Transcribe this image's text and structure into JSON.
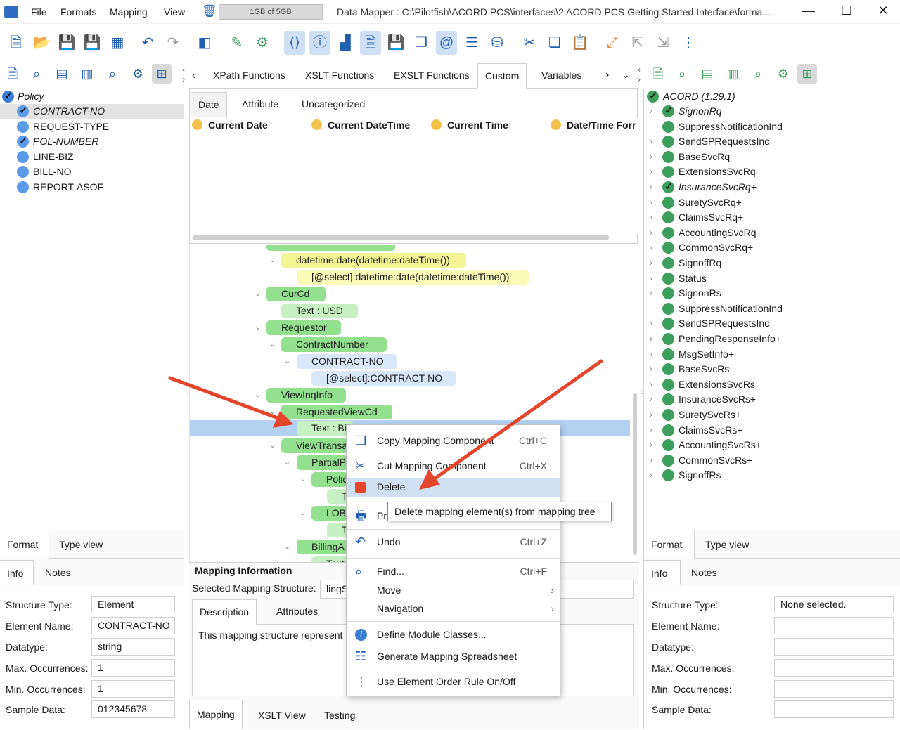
{
  "menubar": {
    "items": [
      "File",
      "Formats",
      "Mapping",
      "View"
    ]
  },
  "memory": "1GB of 5GB",
  "window_title": "Data Mapper : C:\\Pilotfish\\ACORD PCS\\interfaces\\2 ACORD PCS Getting Started Interface\\forma...",
  "left_tree": {
    "root": "Policy",
    "items": [
      {
        "label": "CONTRACT-NO",
        "checked": true,
        "italic": true,
        "selected": true
      },
      {
        "label": "REQUEST-TYPE",
        "checked": false,
        "italic": false
      },
      {
        "label": "POL-NUMBER",
        "checked": true,
        "italic": true
      },
      {
        "label": "LINE-BIZ",
        "checked": false,
        "italic": false
      },
      {
        "label": "BILL-NO",
        "checked": false,
        "italic": false
      },
      {
        "label": "REPORT-ASOF",
        "checked": false,
        "italic": false
      }
    ]
  },
  "func_tabs": [
    "XPath Functions",
    "XSLT Functions",
    "EXSLT Functions",
    "Custom",
    "Variables"
  ],
  "func_active": "Custom",
  "sub_tabs": [
    "Date",
    "Attribute",
    "Uncategorized"
  ],
  "sub_active": "Date",
  "functions": [
    "Current Date",
    "Current DateTime",
    "Current Time",
    "Date/Time Forr"
  ],
  "mapping_tree": [
    {
      "label": "datetime:date(datetime:dateTime())"
    },
    {
      "label": "[@select]:datetime:date(datetime:dateTime())"
    },
    {
      "label": "CurCd"
    },
    {
      "label": "Text : USD"
    },
    {
      "label": "Requestor"
    },
    {
      "label": "ContractNumber"
    },
    {
      "label": "CONTRACT-NO"
    },
    {
      "label": "[@select]:CONTRACT-NO"
    },
    {
      "label": "ViewInqInfo"
    },
    {
      "label": "RequestedViewCd"
    },
    {
      "label": "Text : Bi"
    },
    {
      "label": "ViewTransa"
    },
    {
      "label": "PartialP"
    },
    {
      "label": "Polic"
    },
    {
      "label": "T"
    },
    {
      "label": "LOB"
    },
    {
      "label": "T"
    },
    {
      "label": "BillingA"
    },
    {
      "label": "Text"
    }
  ],
  "mapping_info": {
    "title": "Mapping Information",
    "selected_label": "Selected Mapping Structure:",
    "selected_value": "lingS",
    "tabs": [
      "Description",
      "Attributes"
    ],
    "description": "This mapping structure represent"
  },
  "bottom_tabs": [
    "Mapping",
    "XSLT View",
    "Testing"
  ],
  "left_props": {
    "view_tabs": [
      "Format",
      "Type view"
    ],
    "info_tabs": [
      "Info",
      "Notes"
    ],
    "rows": [
      {
        "label": "Structure Type:",
        "value": "Element"
      },
      {
        "label": "Element Name:",
        "value": "CONTRACT-NO"
      },
      {
        "label": "Datatype:",
        "value": "string"
      },
      {
        "label": "Max. Occurrences:",
        "value": "1"
      },
      {
        "label": "Min. Occurrences:",
        "value": "1"
      },
      {
        "label": "Sample Data:",
        "value": "012345678"
      }
    ]
  },
  "right_tree": {
    "root": "ACORD (1.29.1)",
    "items": [
      {
        "label": "SignonRq",
        "checked": true,
        "italic": true,
        "chevron": true
      },
      {
        "label": "SuppressNotificationInd",
        "checked": false,
        "chevron": false
      },
      {
        "label": "SendSPRequestsInd",
        "checked": false,
        "chevron": true
      },
      {
        "label": "BaseSvcRq",
        "checked": false,
        "chevron": true
      },
      {
        "label": "ExtensionsSvcRq",
        "checked": false,
        "chevron": true
      },
      {
        "label": "InsuranceSvcRq+",
        "checked": true,
        "italic": true,
        "chevron": true
      },
      {
        "label": "SuretySvcRq+",
        "checked": false,
        "chevron": true
      },
      {
        "label": "ClaimsSvcRq+",
        "checked": false,
        "chevron": true
      },
      {
        "label": "AccountingSvcRq+",
        "checked": false,
        "chevron": true
      },
      {
        "label": "CommonSvcRq+",
        "checked": false,
        "chevron": true
      },
      {
        "label": "SignoffRq",
        "checked": false,
        "chevron": true
      },
      {
        "label": "Status",
        "checked": false,
        "chevron": true
      },
      {
        "label": "SignonRs",
        "checked": false,
        "chevron": true
      },
      {
        "label": "SuppressNotificationInd",
        "checked": false,
        "chevron": false
      },
      {
        "label": "SendSPRequestsInd",
        "checked": false,
        "chevron": true
      },
      {
        "label": "PendingResponseInfo+",
        "checked": false,
        "chevron": true
      },
      {
        "label": "MsgSetInfo+",
        "checked": false,
        "chevron": true
      },
      {
        "label": "BaseSvcRs",
        "checked": false,
        "chevron": true
      },
      {
        "label": "ExtensionsSvcRs",
        "checked": false,
        "chevron": true
      },
      {
        "label": "InsuranceSvcRs+",
        "checked": false,
        "chevron": true
      },
      {
        "label": "SuretySvcRs+",
        "checked": false,
        "chevron": true
      },
      {
        "label": "ClaimsSvcRs+",
        "checked": false,
        "chevron": true
      },
      {
        "label": "AccountingSvcRs+",
        "checked": false,
        "chevron": true
      },
      {
        "label": "CommonSvcRs+",
        "checked": false,
        "chevron": true
      },
      {
        "label": "SignoffRs",
        "checked": false,
        "chevron": true
      }
    ]
  },
  "right_props": {
    "view_tabs": [
      "Format",
      "Type view"
    ],
    "info_tabs": [
      "Info",
      "Notes"
    ],
    "rows": [
      {
        "label": "Structure Type:",
        "value": "None selected."
      },
      {
        "label": "Element Name:",
        "value": ""
      },
      {
        "label": "Datatype:",
        "value": ""
      },
      {
        "label": "Max. Occurrences:",
        "value": ""
      },
      {
        "label": "Min. Occurrences:",
        "value": ""
      },
      {
        "label": "Sample Data:",
        "value": ""
      }
    ]
  },
  "context_menu": {
    "items": [
      {
        "label": "Copy Mapping Component",
        "shortcut": "Ctrl+C",
        "icon": "copy-icon"
      },
      {
        "label": "Cut Mapping Component",
        "shortcut": "Ctrl+X",
        "icon": "scissors-icon"
      },
      {
        "label": "Delete",
        "shortcut": "",
        "icon": "delete-icon"
      },
      {
        "label": "Pri",
        "shortcut": "",
        "icon": "printer-icon"
      },
      {
        "label": "Undo",
        "shortcut": "Ctrl+Z",
        "icon": "undo-icon"
      },
      {
        "label": "Find...",
        "shortcut": "Ctrl+F",
        "icon": "search-icon"
      },
      {
        "label": "Move",
        "shortcut": "",
        "icon": ""
      },
      {
        "label": "Navigation",
        "shortcut": "",
        "icon": ""
      },
      {
        "label": "Define Module Classes...",
        "shortcut": "",
        "icon": "info-icon"
      },
      {
        "label": "Generate Mapping Spreadsheet",
        "shortcut": "",
        "icon": "list-icon"
      },
      {
        "label": "Use Element Order Rule On/Off",
        "shortcut": "",
        "icon": "order-icon"
      }
    ],
    "tooltip": "Delete mapping element(s) from mapping tree"
  },
  "colors": {
    "accent": "#1f5fb0",
    "selection": "#b3d2f2",
    "green_node": "#93e08f",
    "arrow": "#e5452b"
  }
}
